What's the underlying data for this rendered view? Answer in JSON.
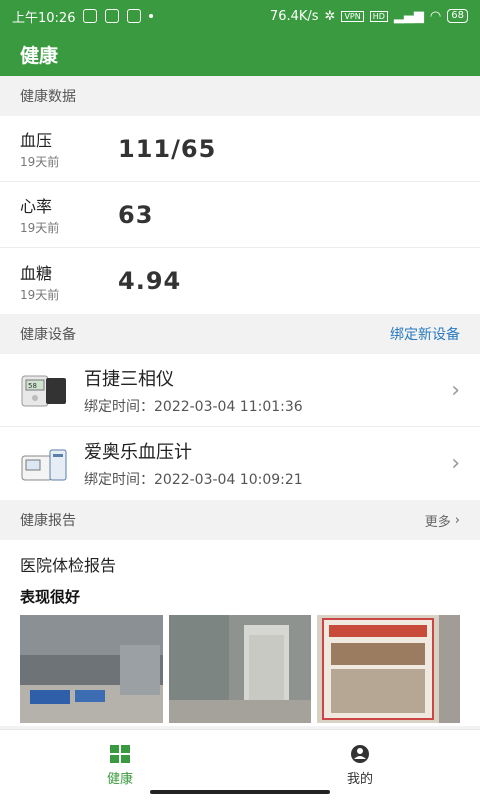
{
  "status_bar": {
    "time": "上午10:26",
    "network_speed": "76.4K/s",
    "battery": "68",
    "vpn": "VPN",
    "hd": "HD"
  },
  "app_bar": {
    "title": "健康"
  },
  "health_data": {
    "header": "健康数据",
    "items": [
      {
        "name": "血压",
        "time": "19天前",
        "value": "111/65"
      },
      {
        "name": "心率",
        "time": "19天前",
        "value": "63"
      },
      {
        "name": "血糖",
        "time": "19天前",
        "value": "4.94"
      }
    ]
  },
  "devices": {
    "header": "健康设备",
    "bind_new": "绑定新设备",
    "items": [
      {
        "name": "百捷三相仪",
        "bind_time": "绑定时间：2022-03-04 11:01:36",
        "icon": "tri-meter-device-icon"
      },
      {
        "name": "爱奥乐血压计",
        "bind_time": "绑定时间：2022-03-04 10:09:21",
        "icon": "blood-pressure-monitor-icon"
      }
    ]
  },
  "reports": {
    "header": "健康报告",
    "more": "更多",
    "title": "医院体检报告",
    "subtitle": "表现很好"
  },
  "nav": {
    "items": [
      {
        "label": "健康",
        "icon": "grid-icon",
        "active": true
      },
      {
        "label": "我的",
        "icon": "user-icon",
        "active": false
      }
    ]
  },
  "colors": {
    "primary": "#3a9a3f",
    "link": "#2a7bbf"
  }
}
